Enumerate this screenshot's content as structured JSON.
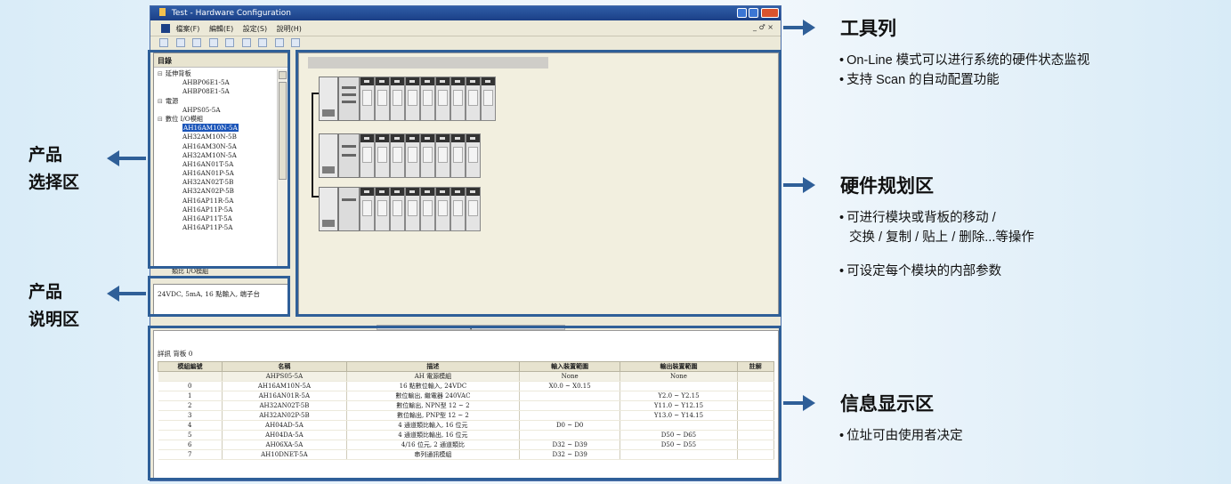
{
  "window": {
    "title": "Test - Hardware Configuration",
    "menu": [
      "檔案(F)",
      "編輯(E)",
      "設定(S)",
      "說明(H)"
    ],
    "mdi_controls": "_ ♂ ×"
  },
  "product_tree": {
    "header": "目錄",
    "items": [
      {
        "text": "延伸背板",
        "kind": "cat"
      },
      {
        "text": "AHBP06E1-5A",
        "kind": "leaf"
      },
      {
        "text": "AHBP08E1-5A",
        "kind": "leaf"
      },
      {
        "text": "電源",
        "kind": "cat"
      },
      {
        "text": "AHPS05-5A",
        "kind": "leaf"
      },
      {
        "text": "數位 I/O模組",
        "kind": "cat"
      },
      {
        "text": "AH16AM10N-5A",
        "kind": "leaf",
        "selected": true
      },
      {
        "text": "AH32AM10N-5B",
        "kind": "leaf"
      },
      {
        "text": "AH16AM30N-5A",
        "kind": "leaf"
      },
      {
        "text": "AH32AM10N-5A",
        "kind": "leaf"
      },
      {
        "text": "AH16AN01T-5A",
        "kind": "leaf"
      },
      {
        "text": "AH16AN01P-5A",
        "kind": "leaf"
      },
      {
        "text": "AH32AN02T-5B",
        "kind": "leaf"
      },
      {
        "text": "AH32AN02P-5B",
        "kind": "leaf"
      },
      {
        "text": "AH16AP11R-5A",
        "kind": "leaf"
      },
      {
        "text": "AH16AP11P-5A",
        "kind": "leaf"
      },
      {
        "text": "AH16AP11T-5A",
        "kind": "leaf"
      },
      {
        "text": "AH16AP11P-5A",
        "kind": "leaf"
      }
    ],
    "footer": "類比 I/O模組"
  },
  "product_desc": {
    "text": "24VDC, 5mA, 16 點輸入, 端子台"
  },
  "info_table": {
    "caption": "詳訊 背板 0",
    "columns": [
      "模組編號",
      "名稱",
      "描述",
      "輸入裝置範圍",
      "輸出裝置範圍",
      "註解"
    ],
    "subrow": [
      "",
      "AHPS05-5A",
      "AH 電源模組",
      "None",
      "None",
      ""
    ],
    "rows": [
      [
        "0",
        "AH16AM10N-5A",
        "16 點數位輸入, 24VDC",
        "X0.0 ~ X0.15",
        "",
        ""
      ],
      [
        "1",
        "AH16AN01R-5A",
        "數位輸出, 繼電器 240VAC",
        "",
        "Y2.0 ~ Y2.15",
        ""
      ],
      [
        "2",
        "AH32AN02T-5B",
        "數位輸出, NPN型 12 ~ 2",
        "",
        "Y11.0 ~ Y12.15",
        ""
      ],
      [
        "3",
        "AH32AN02P-5B",
        "數位輸出, PNP型 12 ~ 2",
        "",
        "Y13.0 ~ Y14.15",
        ""
      ],
      [
        "4",
        "AH04AD-5A",
        "4 通道類比輸入, 16 位元",
        "D0 ~ D0",
        "",
        ""
      ],
      [
        "5",
        "AH04DA-5A",
        "4 通道類比輸出, 16 位元",
        "",
        "D50 ~ D65",
        ""
      ],
      [
        "6",
        "AH06XA-5A",
        "4/16 位元, 2 通道類比",
        "D32 ~ D39",
        "D50 ~ D55",
        ""
      ],
      [
        "7",
        "AH10DNET-5A",
        "串列通訊模組",
        "D32 ~ D39",
        "",
        ""
      ]
    ]
  },
  "labels_left": {
    "product_select": [
      "产品",
      "选择区"
    ],
    "product_desc": [
      "产品",
      "说明区"
    ]
  },
  "annotations": {
    "toolbar": {
      "heading": "工具列",
      "bullets": [
        "On-Line 模式可以进行系统的硬件状态监视",
        "支持 Scan 的自动配置功能"
      ]
    },
    "hardware": {
      "heading": "硬件规划区",
      "bullets": [
        "可进行模块或背板的移动 /",
        "交换 / 复制 / 贴上 / 删除...等操作",
        "可设定每个模块的内部参数"
      ]
    },
    "info": {
      "heading": "信息显示区",
      "bullets": [
        "位址可由使用者决定"
      ]
    }
  },
  "colors": {
    "accent": "#2f5f98",
    "title_bar": "#1b3f86",
    "window_bg": "#ece9d8"
  }
}
